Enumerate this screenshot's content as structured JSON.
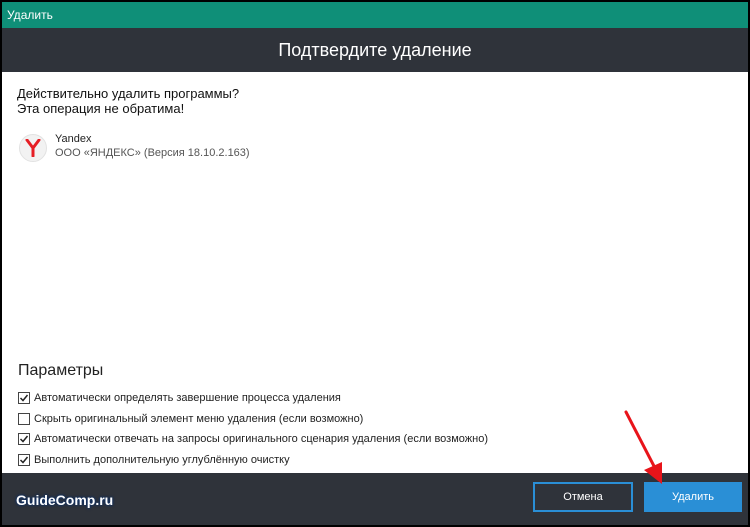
{
  "window": {
    "title": "Удалить"
  },
  "header": {
    "title": "Подтвердите удаление"
  },
  "question": {
    "line1": "Действительно удалить программы?",
    "line2": "Эта операция не обратима!"
  },
  "program": {
    "name": "Yandex",
    "publisher": "ООО «ЯНДЕКС» (Версия 18.10.2.163)",
    "icon": "yandex-browser-icon"
  },
  "params": {
    "title": "Параметры",
    "options": [
      {
        "label": "Автоматически определять завершение процесса удаления",
        "checked": true
      },
      {
        "label": "Скрыть оригинальный элемент меню удаления (если возможно)",
        "checked": false
      },
      {
        "label": "Автоматически отвечать на запросы оригинального сценария удаления (если возможно)",
        "checked": true
      },
      {
        "label": "Выполнить дополнительную углублённую очистку",
        "checked": true
      }
    ]
  },
  "footer": {
    "watermark": "GuideComp.ru",
    "cancel_label": "Отмена",
    "delete_label": "Удалить"
  },
  "colors": {
    "titlebar": "#0f8f78",
    "header": "#2f333a",
    "accent": "#2a8fd6",
    "arrow": "#e8141a"
  }
}
